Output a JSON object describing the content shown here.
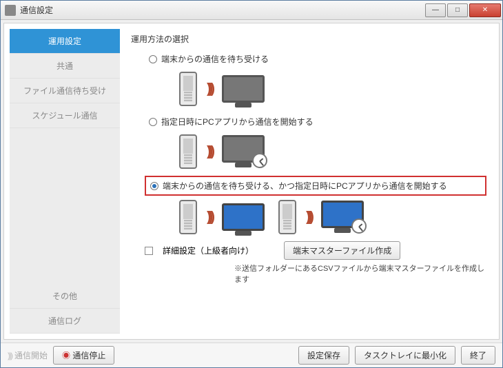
{
  "window": {
    "title": "通信設定"
  },
  "sidebar": {
    "items": [
      {
        "label": "運用設定",
        "active": true
      },
      {
        "label": "共通"
      },
      {
        "label": "ファイル通信待ち受け"
      },
      {
        "label": "スケジュール通信"
      }
    ],
    "bottom": [
      {
        "label": "その他"
      },
      {
        "label": "通信ログ"
      }
    ]
  },
  "section": {
    "title": "運用方法の選択"
  },
  "options": {
    "o1": {
      "label": "端末からの通信を待ち受ける",
      "selected": false
    },
    "o2": {
      "label": "指定日時にPCアプリから通信を開始する",
      "selected": false
    },
    "o3": {
      "label": "端末からの通信を待ち受ける、かつ指定日時にPCアプリから通信を開始する",
      "selected": true
    }
  },
  "advanced": {
    "checkbox_label": "詳細設定（上級者向け）"
  },
  "master_button": {
    "label": "端末マスターファイル作成"
  },
  "note": {
    "text": "※送信フォルダーにあるCSVファイルから端末マスターファイルを作成します"
  },
  "footer": {
    "status": "通信開始",
    "stop": "通信停止",
    "save": "設定保存",
    "minimize": "タスクトレイに最小化",
    "exit": "終了"
  }
}
